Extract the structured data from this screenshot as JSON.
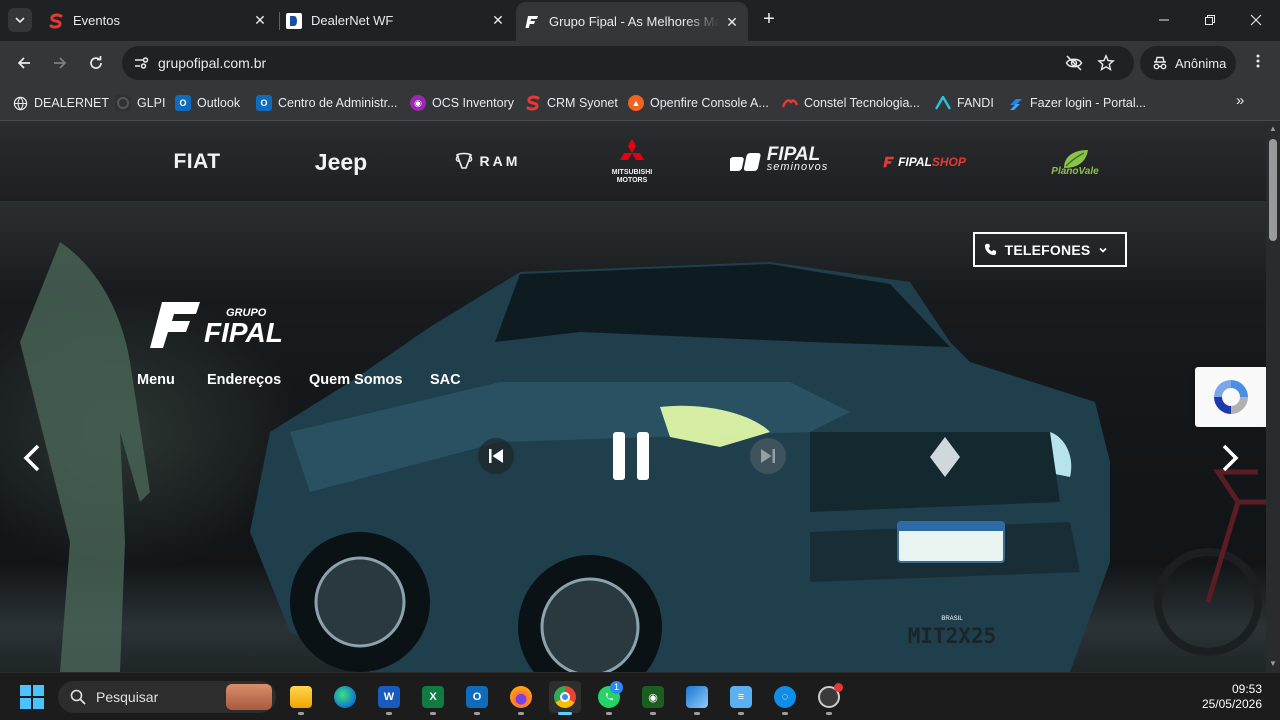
{
  "browser": {
    "tabs": [
      {
        "title": "Eventos",
        "icon": "s-red-icon",
        "active": false
      },
      {
        "title": "DealerNet WF",
        "icon": "d-blue-icon",
        "active": false
      },
      {
        "title": "Grupo Fipal - As Melhores Marcas",
        "icon": "fipal-f-icon",
        "active": true
      }
    ],
    "url": "grupofipal.com.br",
    "profile_label": "Anônima",
    "bookmarks": [
      {
        "label": "DEALERNET",
        "icon": "globe-icon"
      },
      {
        "label": "GLPI",
        "icon": "glpi-icon"
      },
      {
        "label": "Outlook",
        "icon": "outlook-icon"
      },
      {
        "label": "Centro de Administr...",
        "icon": "outlook-icon"
      },
      {
        "label": "OCS Inventory",
        "icon": "ocs-icon"
      },
      {
        "label": "CRM Syonet",
        "icon": "syonet-icon"
      },
      {
        "label": "Openfire Console A...",
        "icon": "openfire-icon"
      },
      {
        "label": "Constel Tecnologia...",
        "icon": "constel-icon"
      },
      {
        "label": "FANDI",
        "icon": "fandi-icon"
      },
      {
        "label": "Fazer login - Portal...",
        "icon": "portal-icon"
      }
    ]
  },
  "page": {
    "brands": {
      "fiat": "FIAT",
      "jeep": "Jeep",
      "ram": "RAM",
      "mitsubishi_line1": "MITSUBISHI",
      "mitsubishi_line2": "MOTORS",
      "seminovos_main": "FIPAL",
      "seminovos_sub": "seminovos",
      "shop_main": "FIPAL",
      "shop_sub": "SHOP",
      "planovale": "PlanoVale"
    },
    "logo": {
      "top": "GRUPO",
      "main": "FIPAL"
    },
    "nav": [
      "Menu",
      "Endereços",
      "Quem Somos",
      "SAC"
    ],
    "phones_label": "TELEFONES",
    "plate": {
      "country": "BRASIL",
      "number": "MIT2X25"
    }
  },
  "taskbar": {
    "search_placeholder": "Pesquisar",
    "time": "09:53",
    "date": "25/05/2026",
    "whatsapp_badge": "1"
  }
}
